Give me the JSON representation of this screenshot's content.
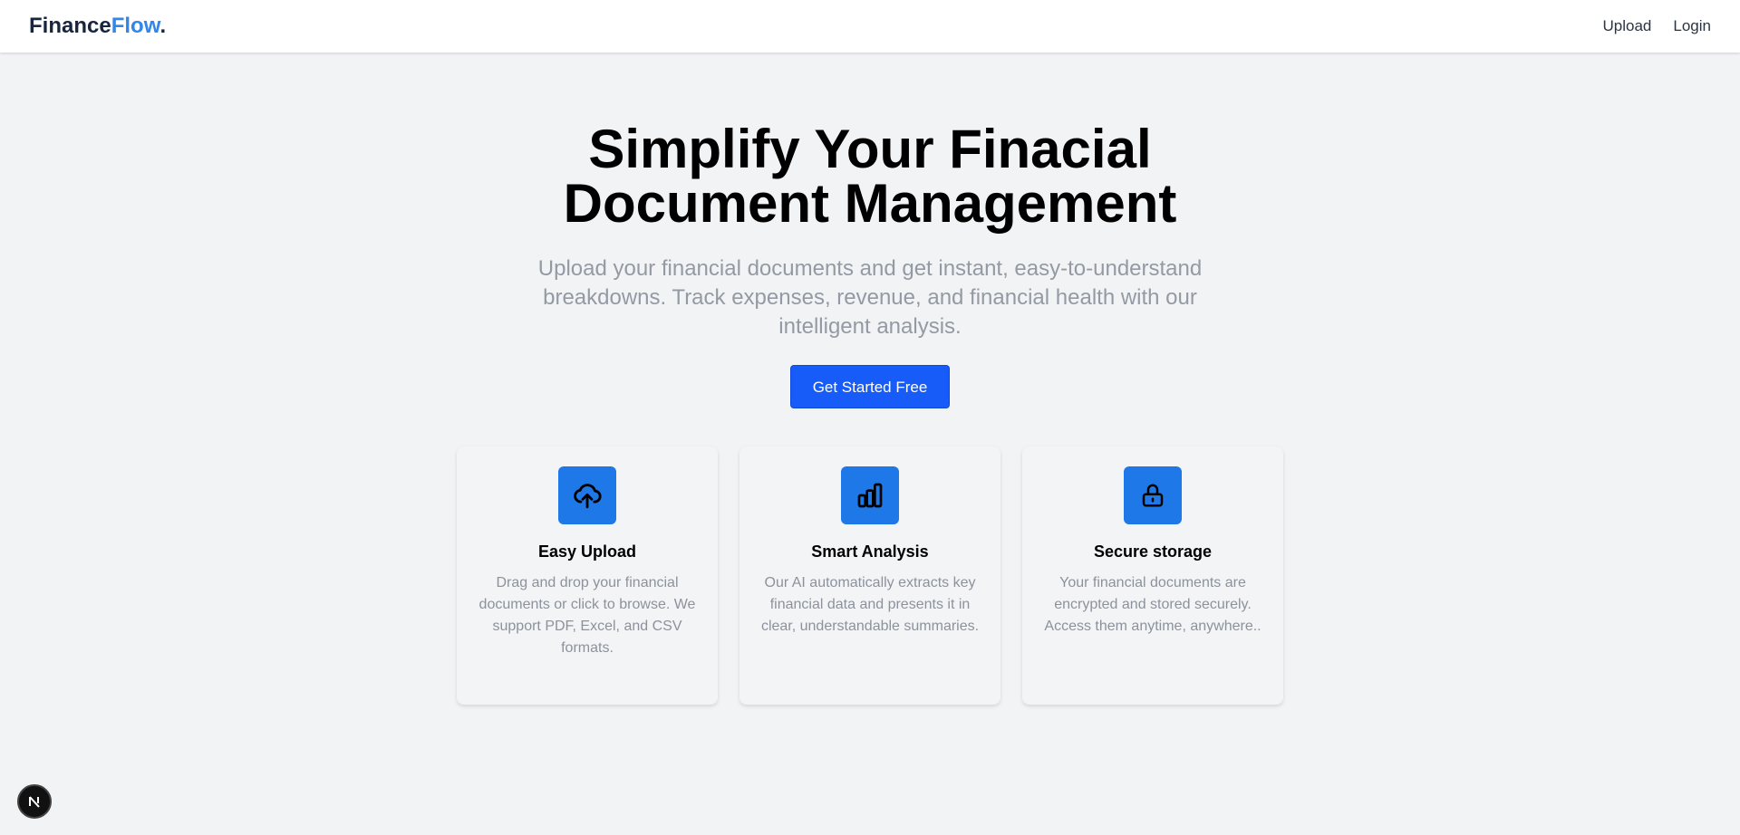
{
  "brand": {
    "name_part1": "Finance",
    "name_part2": "Flow",
    "dot": "."
  },
  "nav": {
    "upload": "Upload",
    "login": "Login"
  },
  "hero": {
    "title_line1": "Simplify Your Finacial",
    "title_line2": "Document Management",
    "subtitle": "Upload your financial documents and get instant, easy-to-understand breakdowns. Track expenses, revenue, and financial health with our intelligent analysis.",
    "cta": "Get Started Free"
  },
  "features": [
    {
      "icon": "cloud-upload-icon",
      "title": "Easy Upload",
      "desc": "Drag and drop your financial documents or click to browse. We support PDF, Excel, and CSV formats."
    },
    {
      "icon": "bar-chart-icon",
      "title": "Smart Analysis",
      "desc": "Our AI automatically extracts key financial data and presents it in clear, understandable summaries."
    },
    {
      "icon": "lock-icon",
      "title": "Secure storage",
      "desc": "Your financial documents are encrypted and stored securely. Access them anytime, anywhere.."
    }
  ],
  "badge": {
    "letter": "N"
  },
  "colors": {
    "brand_accent": "#2f86eb",
    "cta": "#175bf9",
    "icon_bg": "#1f78e8",
    "background": "#f2f3f5"
  }
}
